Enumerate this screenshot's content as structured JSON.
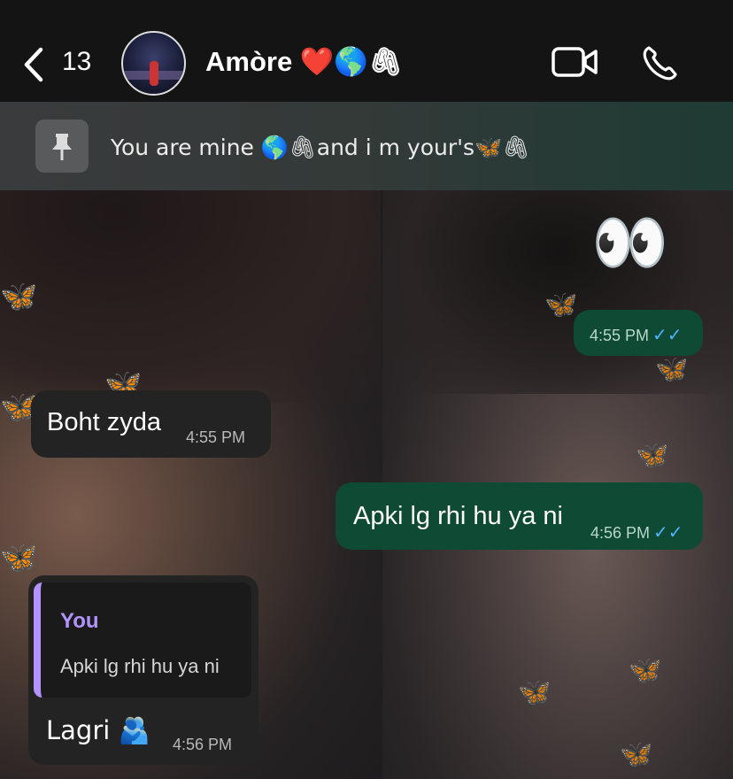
{
  "header": {
    "back_count": "13",
    "contact_name": "Amòre",
    "contact_emojis": "❤️🌎🖇",
    "icons": {
      "back": "chevron-left-icon",
      "video": "video-camera-icon",
      "call": "phone-icon"
    }
  },
  "pinned": {
    "text": "You are mine 🌎🖇and i m your's🦋🖇",
    "icon": "pin-icon"
  },
  "messages": [
    {
      "type": "outgoing",
      "text": "👀",
      "time": "4:55 PM",
      "ticks": "✓✓"
    },
    {
      "type": "incoming",
      "text": "Boht zyda",
      "time": "4:55 PM"
    },
    {
      "type": "outgoing",
      "text": "Apki lg rhi hu ya ni",
      "time": "4:56 PM",
      "ticks": "✓✓"
    },
    {
      "type": "incoming",
      "reply_name": "You",
      "reply_text": "Apki lg rhi hu ya ni",
      "text": "Lagri 🫂",
      "time": "4:56 PM"
    }
  ],
  "colors": {
    "header_bg": "#141414",
    "incoming_bubble": "#232323",
    "outgoing_bubble": "#0e4a34",
    "reply_accent": "#b493ff",
    "tick_blue": "#4fb4ff"
  }
}
